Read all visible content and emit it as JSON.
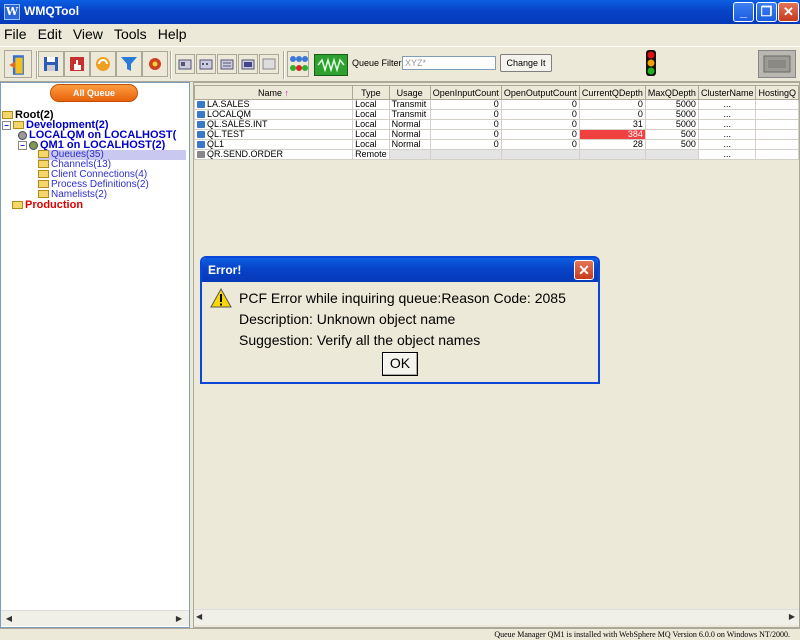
{
  "window": {
    "title": "WMQTool",
    "icon_letter": "W"
  },
  "menu": [
    "File",
    "Edit",
    "View",
    "Tools",
    "Help"
  ],
  "toolbar": {
    "queue_filter_label": "Queue Filter:",
    "queue_filter_placeholder": "XYZ*",
    "change_button": "Change It"
  },
  "tree": {
    "all_qm_button": "All Queue Managers",
    "nodes": {
      "root": "Root(2)",
      "development": "Development(2)",
      "localqm": "LOCALQM on LOCALHOST(",
      "qm1": "QM1 on LOCALHOST(2)",
      "queues": "Queues(35)",
      "channels": "Channels(13)",
      "client_connections": "Client Connections(4)",
      "process_definitions": "Process Definitions(2)",
      "namelists": "Namelists(2)",
      "production": "Production"
    }
  },
  "table": {
    "columns": [
      "Name",
      "Type",
      "Usage",
      "OpenInputCount",
      "OpenOutputCount",
      "CurrentQDepth",
      "MaxQDepth",
      "ClusterName",
      "HostingQ"
    ],
    "sort_arrow": "↑",
    "rows": [
      {
        "name": "LA.SALES",
        "type": "Local",
        "usage": "Transmit",
        "in": "0",
        "out": "0",
        "cur": "0",
        "max": "5000",
        "cluster": "...",
        "hosting": ""
      },
      {
        "name": "LOCALQM",
        "type": "Local",
        "usage": "Transmit",
        "in": "0",
        "out": "0",
        "cur": "0",
        "max": "5000",
        "cluster": "...",
        "hosting": ""
      },
      {
        "name": "QL.SALES.INT",
        "type": "Local",
        "usage": "Normal",
        "in": "0",
        "out": "0",
        "cur": "31",
        "max": "5000",
        "cluster": "...",
        "hosting": ""
      },
      {
        "name": "QL.TEST",
        "type": "Local",
        "usage": "Normal",
        "in": "0",
        "out": "0",
        "cur": "384",
        "max": "500",
        "cluster": "...",
        "hosting": ""
      },
      {
        "name": "QL1",
        "type": "Local",
        "usage": "Normal",
        "in": "0",
        "out": "0",
        "cur": "28",
        "max": "500",
        "cluster": "...",
        "hosting": ""
      },
      {
        "name": "QR.SEND.ORDER",
        "type": "Remote",
        "usage": "",
        "in": "",
        "out": "",
        "cur": "",
        "max": "",
        "cluster": "...",
        "hosting": ""
      }
    ]
  },
  "status": "Queue Manager QM1 is installed with WebSphere MQ Version 6.0.0 on Windows NT/2000.",
  "dialog": {
    "title": "Error!",
    "line1": "PCF Error while inquiring queue:Reason Code: 2085",
    "line2": "Description: Unknown object name",
    "line3": "Suggestion: Verify all the object names",
    "ok": "OK"
  }
}
